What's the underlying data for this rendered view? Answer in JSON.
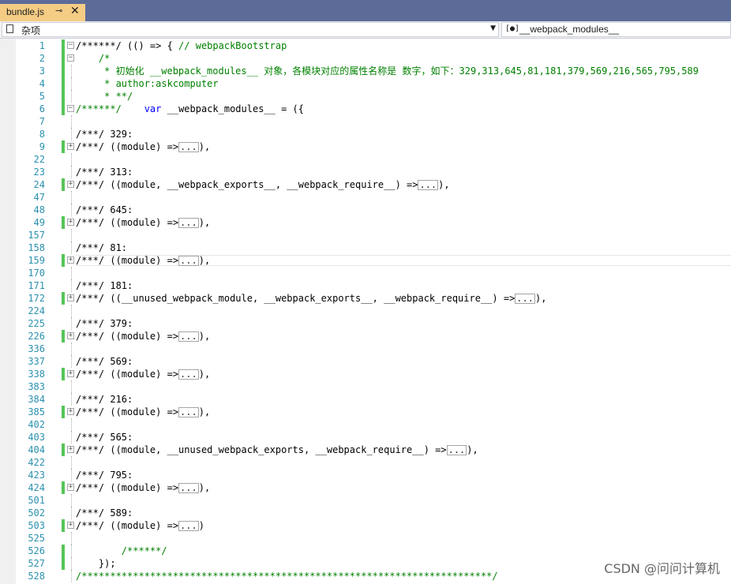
{
  "tab": {
    "title": "bundle.js",
    "pin_glyph": "⊸",
    "close_glyph": "✕"
  },
  "navigation": {
    "project_label": "杂项",
    "project_icon": "file-icon",
    "member_label": "__webpack_modules__",
    "member_icon": "module-icon",
    "member_icon_glyph": "[●]"
  },
  "colors": {
    "comment": "#008000",
    "keyword": "#0000ff",
    "line_number": "#2b91af",
    "change_marker": "#57c457",
    "tab_background": "#f5cc84",
    "tabbar_background": "#5d6b99"
  },
  "code_lines": [
    {
      "num": "1",
      "fold": "−",
      "chg": true,
      "segs": [
        {
          "t": "/******/ (() => { ",
          "c": "p"
        },
        {
          "t": "// webpackBootstrap",
          "c": "c"
        }
      ]
    },
    {
      "num": "2",
      "fold": "−",
      "chg": true,
      "segs": [
        {
          "t": "    /*",
          "c": "c"
        }
      ]
    },
    {
      "num": "3",
      "chg": true,
      "segs": [
        {
          "t": "     * 初始化 __webpack_modules__ 对象，各模块对应的属性名称是 数字，如下：329,313,645,81,181,379,569,216,565,795,589",
          "c": "c"
        }
      ]
    },
    {
      "num": "4",
      "chg": true,
      "segs": [
        {
          "t": "     * author:askcomputer",
          "c": "c"
        }
      ]
    },
    {
      "num": "5",
      "chg": true,
      "segs": [
        {
          "t": "     * **/",
          "c": "c"
        }
      ]
    },
    {
      "num": "6",
      "fold": "−",
      "chg": true,
      "segs": [
        {
          "t": "/******/    ",
          "c": "c"
        },
        {
          "t": "var",
          "c": "k"
        },
        {
          "t": " __webpack_modules__ = ({",
          "c": "p"
        }
      ]
    },
    {
      "num": "7",
      "segs": []
    },
    {
      "num": "8",
      "segs": [
        {
          "t": "/***/ 329:",
          "c": "p"
        }
      ]
    },
    {
      "num": "9",
      "fold": "+",
      "chg": true,
      "segs": [
        {
          "t": "/***/ ((module) =>",
          "c": "p"
        },
        {
          "t": "...",
          "c": "box"
        },
        {
          "t": "),",
          "c": "p"
        }
      ]
    },
    {
      "num": "22",
      "segs": []
    },
    {
      "num": "23",
      "segs": [
        {
          "t": "/***/ 313:",
          "c": "p"
        }
      ]
    },
    {
      "num": "24",
      "fold": "+",
      "chg": true,
      "segs": [
        {
          "t": "/***/ ((module, __webpack_exports__, __webpack_require__) =>",
          "c": "p"
        },
        {
          "t": "...",
          "c": "box"
        },
        {
          "t": "),",
          "c": "p"
        }
      ]
    },
    {
      "num": "47",
      "segs": []
    },
    {
      "num": "48",
      "segs": [
        {
          "t": "/***/ 645:",
          "c": "p"
        }
      ]
    },
    {
      "num": "49",
      "fold": "+",
      "chg": true,
      "segs": [
        {
          "t": "/***/ ((module) =>",
          "c": "p"
        },
        {
          "t": "...",
          "c": "box"
        },
        {
          "t": "),",
          "c": "p"
        }
      ]
    },
    {
      "num": "157",
      "segs": []
    },
    {
      "num": "158",
      "segs": [
        {
          "t": "/***/ 81:",
          "c": "p"
        }
      ]
    },
    {
      "num": "159",
      "fold": "+",
      "chg": true,
      "cur": true,
      "segs": [
        {
          "t": "/***/ ((module) =>",
          "c": "p"
        },
        {
          "t": "...",
          "c": "box"
        },
        {
          "t": "),",
          "c": "p"
        }
      ]
    },
    {
      "num": "170",
      "segs": []
    },
    {
      "num": "171",
      "segs": [
        {
          "t": "/***/ 181:",
          "c": "p"
        }
      ]
    },
    {
      "num": "172",
      "fold": "+",
      "chg": true,
      "segs": [
        {
          "t": "/***/ ((__unused_webpack_module, __webpack_exports__, __webpack_require__) =>",
          "c": "p"
        },
        {
          "t": "...",
          "c": "box"
        },
        {
          "t": "),",
          "c": "p"
        }
      ]
    },
    {
      "num": "224",
      "segs": []
    },
    {
      "num": "225",
      "segs": [
        {
          "t": "/***/ 379:",
          "c": "p"
        }
      ]
    },
    {
      "num": "226",
      "fold": "+",
      "chg": true,
      "segs": [
        {
          "t": "/***/ ((module) =>",
          "c": "p"
        },
        {
          "t": "...",
          "c": "box"
        },
        {
          "t": "),",
          "c": "p"
        }
      ]
    },
    {
      "num": "336",
      "segs": []
    },
    {
      "num": "337",
      "segs": [
        {
          "t": "/***/ 569:",
          "c": "p"
        }
      ]
    },
    {
      "num": "338",
      "fold": "+",
      "chg": true,
      "segs": [
        {
          "t": "/***/ ((module) =>",
          "c": "p"
        },
        {
          "t": "...",
          "c": "box"
        },
        {
          "t": "),",
          "c": "p"
        }
      ]
    },
    {
      "num": "383",
      "segs": []
    },
    {
      "num": "384",
      "segs": [
        {
          "t": "/***/ 216:",
          "c": "p"
        }
      ]
    },
    {
      "num": "385",
      "fold": "+",
      "chg": true,
      "segs": [
        {
          "t": "/***/ ((module) =>",
          "c": "p"
        },
        {
          "t": "...",
          "c": "box"
        },
        {
          "t": "),",
          "c": "p"
        }
      ]
    },
    {
      "num": "402",
      "segs": []
    },
    {
      "num": "403",
      "segs": [
        {
          "t": "/***/ 565:",
          "c": "p"
        }
      ]
    },
    {
      "num": "404",
      "fold": "+",
      "chg": true,
      "segs": [
        {
          "t": "/***/ ((module, __unused_webpack_exports, __webpack_require__) =>",
          "c": "p"
        },
        {
          "t": "...",
          "c": "box"
        },
        {
          "t": "),",
          "c": "p"
        }
      ]
    },
    {
      "num": "422",
      "segs": []
    },
    {
      "num": "423",
      "segs": [
        {
          "t": "/***/ 795:",
          "c": "p"
        }
      ]
    },
    {
      "num": "424",
      "fold": "+",
      "chg": true,
      "segs": [
        {
          "t": "/***/ ((module) =>",
          "c": "p"
        },
        {
          "t": "...",
          "c": "box"
        },
        {
          "t": "),",
          "c": "p"
        }
      ]
    },
    {
      "num": "501",
      "segs": []
    },
    {
      "num": "502",
      "segs": [
        {
          "t": "/***/ 589:",
          "c": "p"
        }
      ]
    },
    {
      "num": "503",
      "fold": "+",
      "chg": true,
      "segs": [
        {
          "t": "/***/ ((module) =>",
          "c": "p"
        },
        {
          "t": "...",
          "c": "box"
        },
        {
          "t": ")",
          "c": "p"
        }
      ]
    },
    {
      "num": "525",
      "segs": []
    },
    {
      "num": "526",
      "chg": true,
      "segs": [
        {
          "t": "        /******/",
          "c": "c"
        }
      ]
    },
    {
      "num": "527",
      "chg": true,
      "segs": [
        {
          "t": "    });",
          "c": "p"
        }
      ]
    },
    {
      "num": "528",
      "segs": [
        {
          "t": "/************************************************************************/",
          "c": "c"
        }
      ]
    }
  ],
  "watermark": "CSDN @问问计算机"
}
